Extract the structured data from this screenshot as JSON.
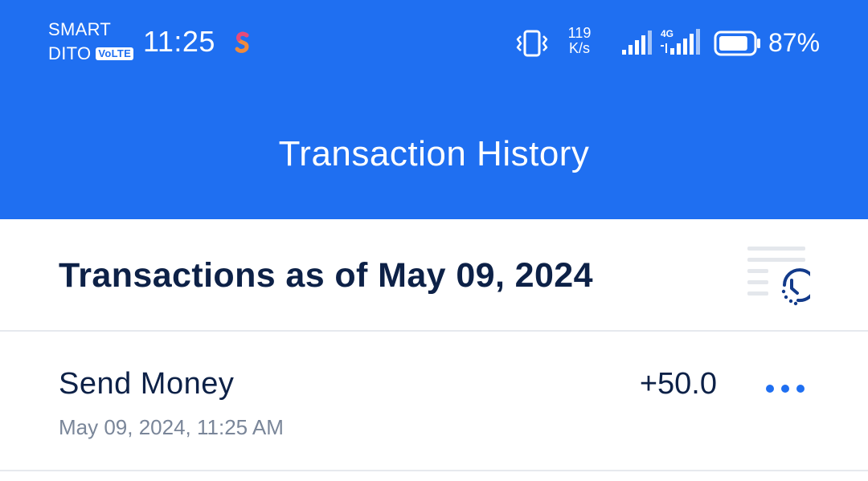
{
  "status_bar": {
    "carrier_line1": "SMART",
    "carrier_line2": "DITO",
    "volte": "VoLTE",
    "time": "11:25",
    "net_speed_value": "119",
    "net_speed_unit": "K/s",
    "network_type": "4G",
    "battery_level": 87,
    "battery_text": "87%",
    "icons": [
      "app-s-badge-icon",
      "vibrate-icon",
      "signal-icon",
      "signal-4g-icon",
      "battery-icon"
    ]
  },
  "header": {
    "title": "Transaction History",
    "background": "#1f6ff1"
  },
  "section": {
    "title": "Transactions as of May 09, 2024",
    "icon": "history-filter-icon"
  },
  "transactions": [
    {
      "type": "Send Money",
      "date": "May 09, 2024, 11:25 AM",
      "amount": "+50.0",
      "more_icon": "more-dots-icon"
    }
  ],
  "colors": {
    "accent": "#1f6ff1",
    "title_text": "#0d2147",
    "muted_text": "#7a8699",
    "divider": "#e6e9ee"
  }
}
